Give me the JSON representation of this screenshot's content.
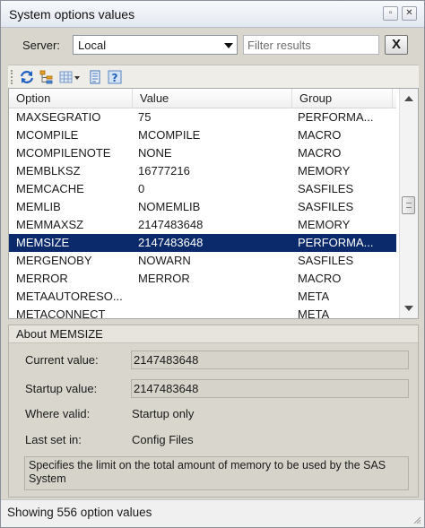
{
  "window": {
    "title": "System options values",
    "close_glyph": "✕",
    "restore_glyph": "▫"
  },
  "filter": {
    "server_label": "Server:",
    "server_value": "Local",
    "placeholder": "Filter results",
    "clear_label": "X"
  },
  "toolbar": {
    "icons": [
      "refresh-icon",
      "tree-view-icon",
      "grid-view-icon",
      "properties-icon",
      "help-icon"
    ]
  },
  "grid": {
    "columns": [
      "Option",
      "Value",
      "Group"
    ],
    "rows": [
      {
        "option": "MAXSEGRATIO",
        "value": "75",
        "group": "PERFORMA..."
      },
      {
        "option": "MCOMPILE",
        "value": "MCOMPILE",
        "group": "MACRO"
      },
      {
        "option": "MCOMPILENOTE",
        "value": "NONE",
        "group": "MACRO"
      },
      {
        "option": "MEMBLKSZ",
        "value": "16777216",
        "group": "MEMORY"
      },
      {
        "option": "MEMCACHE",
        "value": "0",
        "group": "SASFILES"
      },
      {
        "option": "MEMLIB",
        "value": "NOMEMLIB",
        "group": "SASFILES"
      },
      {
        "option": "MEMMAXSZ",
        "value": "2147483648",
        "group": "MEMORY"
      },
      {
        "option": "MEMSIZE",
        "value": "2147483648",
        "group": "PERFORMA...",
        "selected": true
      },
      {
        "option": "MERGENOBY",
        "value": "NOWARN",
        "group": "SASFILES"
      },
      {
        "option": "MERROR",
        "value": "MERROR",
        "group": "MACRO"
      },
      {
        "option": "METAAUTORESO...",
        "value": "",
        "group": "META"
      },
      {
        "option": "METACONNECT",
        "value": "",
        "group": "META"
      }
    ],
    "selected_color": "#0b2a6b"
  },
  "about": {
    "title": "About MEMSIZE",
    "current_label": "Current value:",
    "current_value": "2147483648",
    "startup_label": "Startup value:",
    "startup_value": "2147483648",
    "where_label": "Where valid:",
    "where_value": "Startup only",
    "lastset_label": "Last set in:",
    "lastset_value": "Config Files",
    "description": "Specifies the limit on the total amount of memory to be used by the SAS System"
  },
  "status": {
    "text": "Showing 556 option values"
  }
}
